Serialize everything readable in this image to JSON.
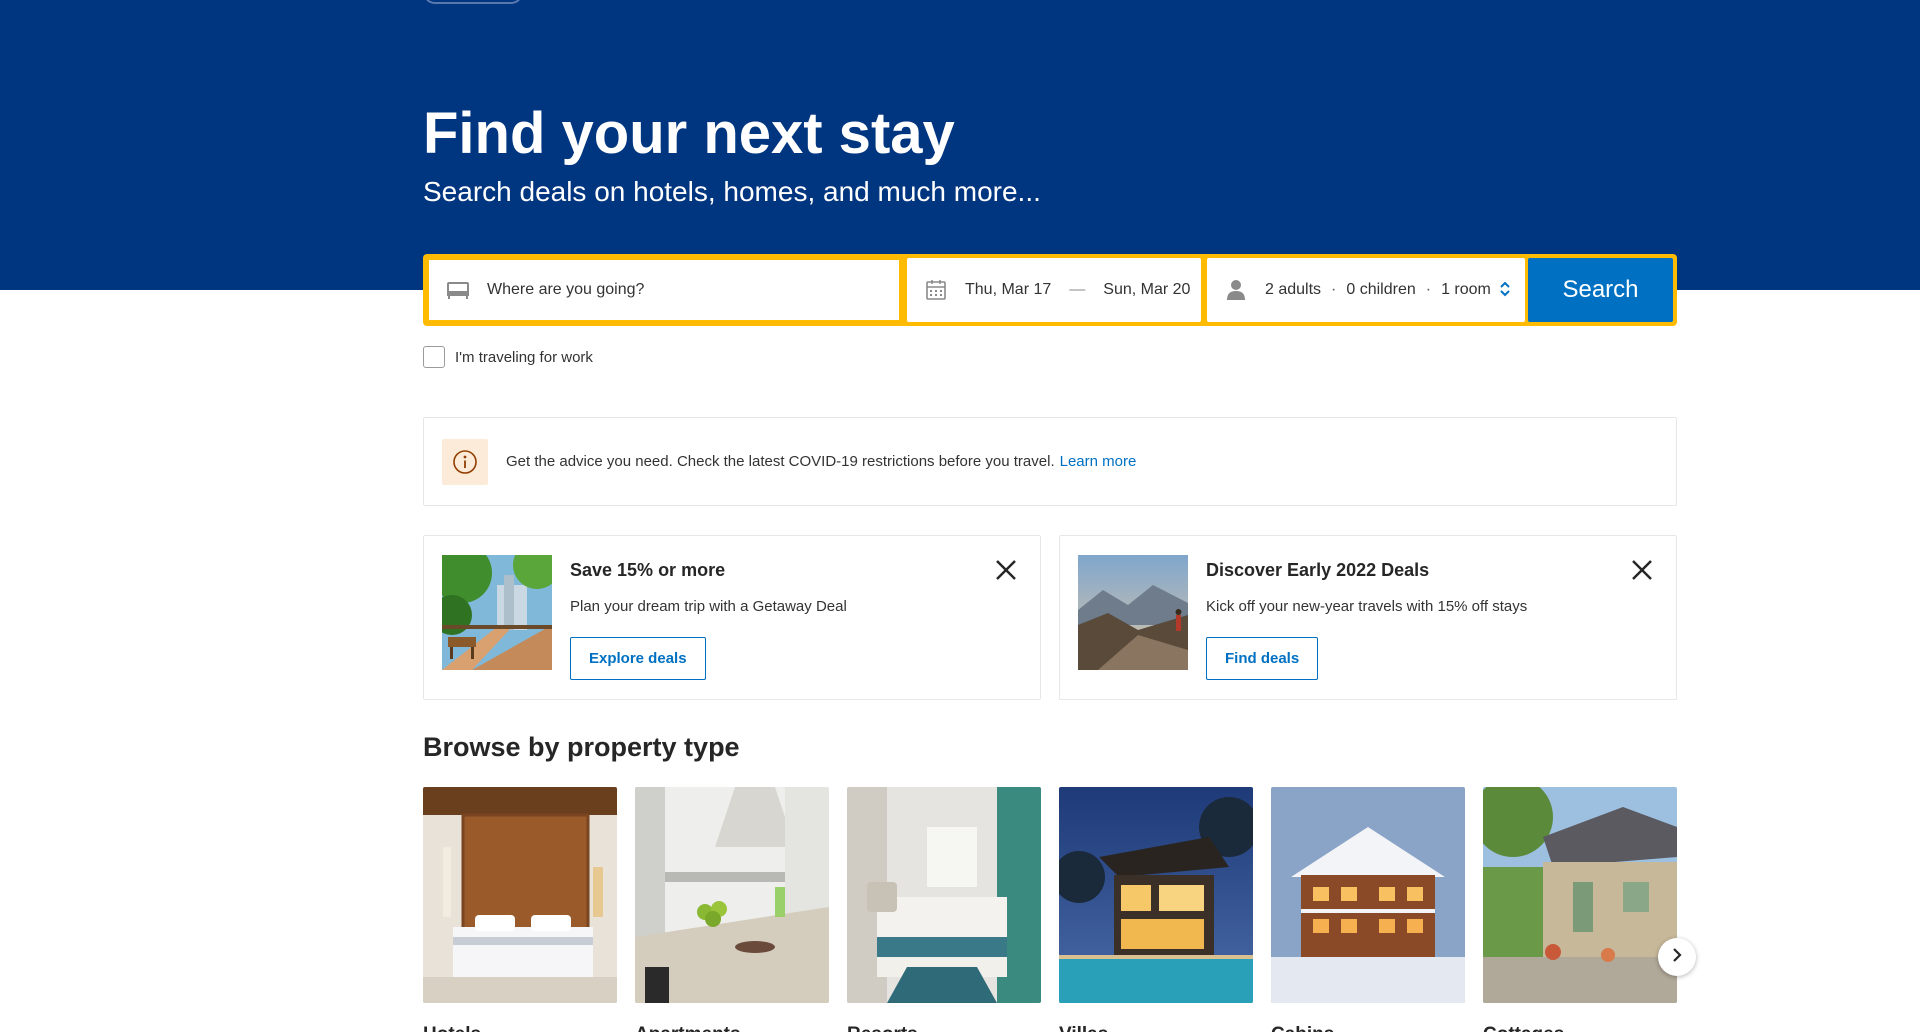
{
  "hero": {
    "title": "Find your next stay",
    "subtitle": "Search deals on hotels, homes, and much more..."
  },
  "search": {
    "destination_placeholder": "Where are you going?",
    "checkin": "Thu, Mar 17",
    "date_separator": "—",
    "checkout": "Sun, Mar 20",
    "adults": "2 adults",
    "children": "0 children",
    "rooms": "1 room",
    "separator": "·",
    "button_label": "Search",
    "work_travel_label": "I'm traveling for work",
    "work_travel_checked": false
  },
  "notice": {
    "text": "Get the advice you need. Check the latest COVID-19 restrictions before you travel.",
    "link_label": "Learn more"
  },
  "promos": [
    {
      "title": "Save 15% or more",
      "text": "Plan your dream trip with a Getaway Deal",
      "button_label": "Explore deals"
    },
    {
      "title": "Discover Early 2022 Deals",
      "text": "Kick off your new-year travels with 15% off stays",
      "button_label": "Find deals"
    }
  ],
  "browse": {
    "title": "Browse by property type",
    "types": [
      {
        "label": "Hotels"
      },
      {
        "label": "Apartments"
      },
      {
        "label": "Resorts"
      },
      {
        "label": "Villas"
      },
      {
        "label": "Cabins"
      },
      {
        "label": "Cottages"
      }
    ]
  },
  "icons": {
    "destination": "bed-icon",
    "dates": "calendar-icon",
    "guests": "person-icon",
    "guests_toggle": "chevron-updown-icon",
    "notice": "info-icon",
    "promo_close": "close-icon",
    "carousel": "chevron-right-icon"
  },
  "colors": {
    "brand_blue": "#003580",
    "accent_yellow": "#febb02",
    "action_blue": "#0071c2"
  }
}
